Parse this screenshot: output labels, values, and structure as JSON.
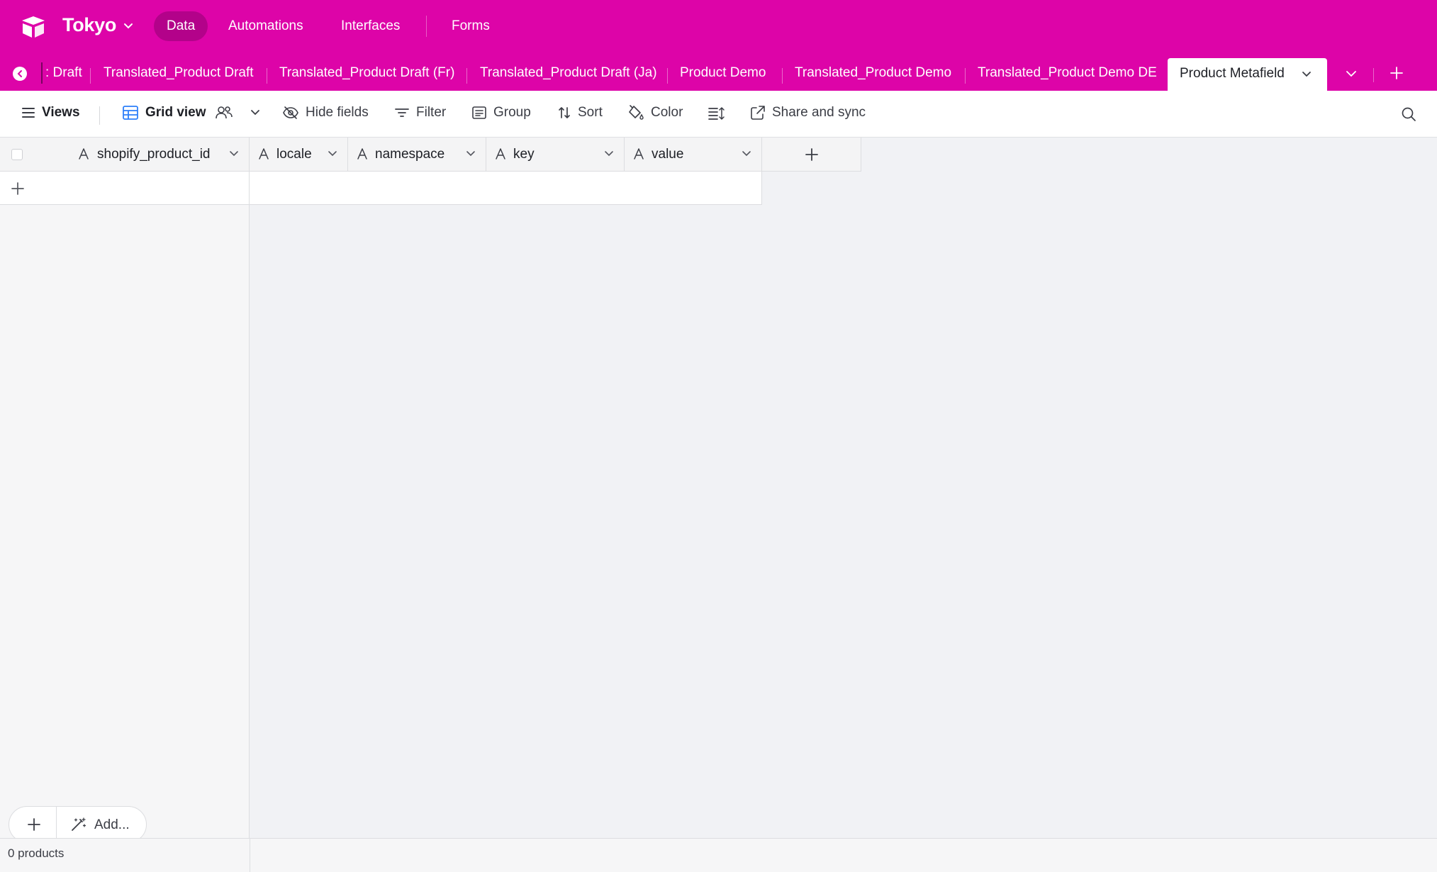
{
  "app": {
    "base_name": "Tokyo",
    "brand_color": "#dd04a8",
    "nav": [
      {
        "label": "Data",
        "active": true
      },
      {
        "label": "Automations",
        "active": false
      },
      {
        "label": "Interfaces",
        "active": false
      },
      {
        "label": "Forms",
        "active": false
      }
    ]
  },
  "tables": {
    "tabs": [
      {
        "label": ": Draft"
      },
      {
        "label": "Translated_Product Draft"
      },
      {
        "label": "Translated_Product Draft (Fr)"
      },
      {
        "label": "Translated_Product Draft (Ja)"
      },
      {
        "label": "Product Demo"
      },
      {
        "label": "Translated_Product Demo"
      },
      {
        "label": "Translated_Product Demo DE"
      }
    ],
    "active_tab": "Product Metafield"
  },
  "toolbar": {
    "views_label": "Views",
    "view_name": "Grid view",
    "hide_fields_label": "Hide fields",
    "filter_label": "Filter",
    "group_label": "Group",
    "sort_label": "Sort",
    "color_label": "Color",
    "share_label": "Share and sync"
  },
  "grid": {
    "fields": [
      {
        "name": "shopify_product_id",
        "type_icon": "text-field-icon"
      },
      {
        "name": "locale",
        "type_icon": "text-field-icon"
      },
      {
        "name": "namespace",
        "type_icon": "text-field-icon"
      },
      {
        "name": "key",
        "type_icon": "text-field-icon"
      },
      {
        "name": "value",
        "type_icon": "text-field-icon"
      }
    ],
    "rows": []
  },
  "footer": {
    "add_label": "Add...",
    "record_count": "0 products"
  }
}
